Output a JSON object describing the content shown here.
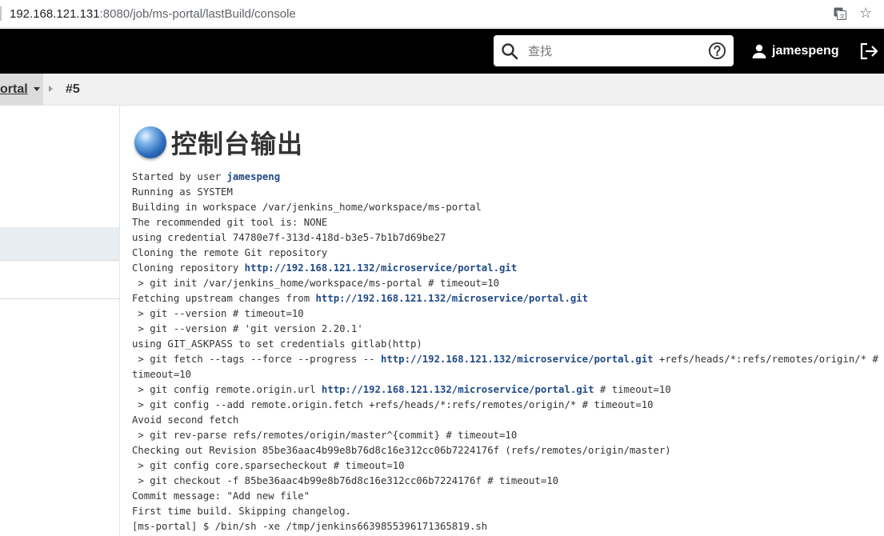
{
  "browser": {
    "url_host": "192.168.121.131",
    "url_rest": ":8080/job/ms-portal/lastBuild/console"
  },
  "header": {
    "search_placeholder": "查找",
    "username": "jamespeng"
  },
  "breadcrumb": {
    "job_label": "ortal",
    "build_label": "#5"
  },
  "main": {
    "title": "控制台输出"
  },
  "console": [
    {
      "parts": [
        {
          "t": "Started by user "
        },
        {
          "t": "jamespeng",
          "link": true
        }
      ]
    },
    {
      "parts": [
        {
          "t": "Running as SYSTEM"
        }
      ]
    },
    {
      "parts": [
        {
          "t": "Building in workspace /var/jenkins_home/workspace/ms-portal"
        }
      ]
    },
    {
      "parts": [
        {
          "t": "The recommended git tool is: NONE"
        }
      ]
    },
    {
      "parts": [
        {
          "t": "using credential 74780e7f-313d-418d-b3e5-7b1b7d69be27"
        }
      ]
    },
    {
      "parts": [
        {
          "t": "Cloning the remote Git repository"
        }
      ]
    },
    {
      "parts": [
        {
          "t": "Cloning repository "
        },
        {
          "t": "http://192.168.121.132/microservice/portal.git",
          "link": true
        }
      ]
    },
    {
      "parts": [
        {
          "t": " > git init /var/jenkins_home/workspace/ms-portal # timeout=10"
        }
      ]
    },
    {
      "parts": [
        {
          "t": "Fetching upstream changes from "
        },
        {
          "t": "http://192.168.121.132/microservice/portal.git",
          "link": true
        }
      ]
    },
    {
      "parts": [
        {
          "t": " > git --version # timeout=10"
        }
      ]
    },
    {
      "parts": [
        {
          "t": " > git --version # 'git version 2.20.1'"
        }
      ]
    },
    {
      "parts": [
        {
          "t": "using GIT_ASKPASS to set credentials gitlab(http)"
        }
      ]
    },
    {
      "parts": [
        {
          "t": " > git fetch --tags --force --progress -- "
        },
        {
          "t": "http://192.168.121.132/microservice/portal.git",
          "link": true
        },
        {
          "t": " +refs/heads/*:refs/remotes/origin/* #"
        }
      ]
    },
    {
      "parts": [
        {
          "t": "timeout=10"
        }
      ]
    },
    {
      "parts": [
        {
          "t": " > git config remote.origin.url "
        },
        {
          "t": "http://192.168.121.132/microservice/portal.git",
          "link": true
        },
        {
          "t": " # timeout=10"
        }
      ]
    },
    {
      "parts": [
        {
          "t": " > git config --add remote.origin.fetch +refs/heads/*:refs/remotes/origin/* # timeout=10"
        }
      ]
    },
    {
      "parts": [
        {
          "t": "Avoid second fetch"
        }
      ]
    },
    {
      "parts": [
        {
          "t": " > git rev-parse refs/remotes/origin/master^{commit} # timeout=10"
        }
      ]
    },
    {
      "parts": [
        {
          "t": "Checking out Revision 85be36aac4b99e8b76d8c16e312cc06b7224176f (refs/remotes/origin/master)"
        }
      ]
    },
    {
      "parts": [
        {
          "t": " > git config core.sparsecheckout # timeout=10"
        }
      ]
    },
    {
      "parts": [
        {
          "t": " > git checkout -f 85be36aac4b99e8b76d8c16e312cc06b7224176f # timeout=10"
        }
      ]
    },
    {
      "parts": [
        {
          "t": "Commit message: \"Add new file\""
        }
      ]
    },
    {
      "parts": [
        {
          "t": "First time build. Skipping changelog."
        }
      ]
    },
    {
      "parts": [
        {
          "t": "[ms-portal] $ /bin/sh -xe /tmp/jenkins6639855396171365819.sh"
        }
      ]
    }
  ]
}
